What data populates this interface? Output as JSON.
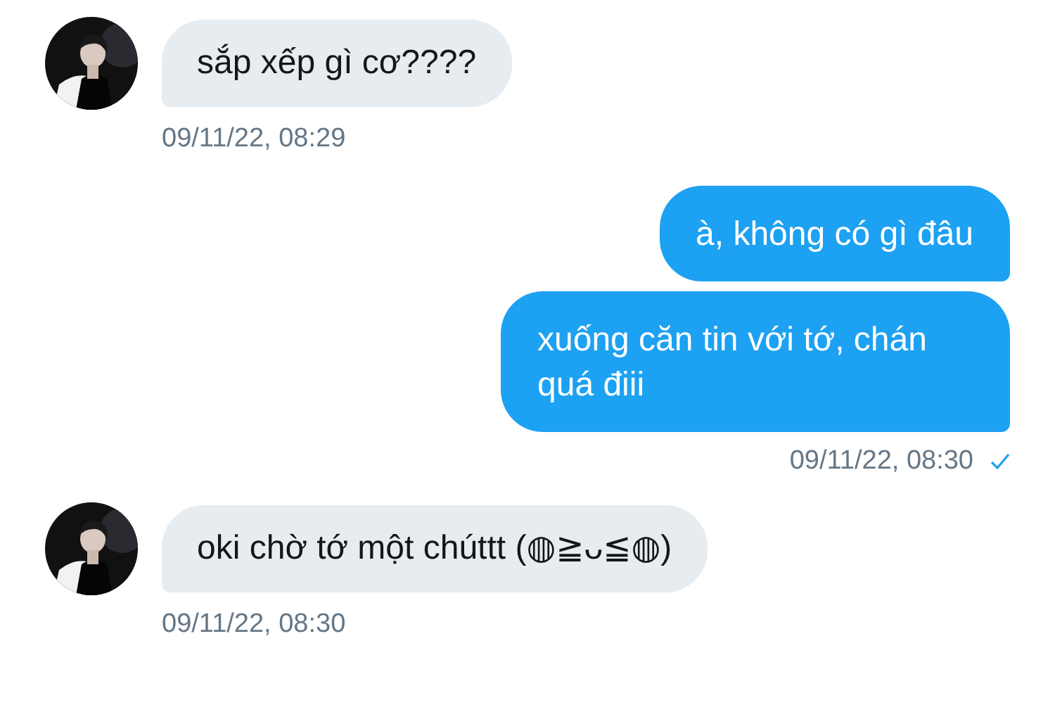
{
  "messages": [
    {
      "kind": "incoming",
      "bubbles": [
        "sắp xếp gì cơ????"
      ],
      "time": "09/11/22, 08:29"
    },
    {
      "kind": "outgoing",
      "bubbles": [
        "à, không có gì đâu",
        "xuống căn tin với tớ, chán quá điii"
      ],
      "time": "09/11/22, 08:30",
      "read": true
    },
    {
      "kind": "incoming",
      "bubbles": [
        "oki chờ tớ một chúttt (◍≧ᴗ≦◍)"
      ],
      "time": "09/11/22, 08:30"
    }
  ]
}
